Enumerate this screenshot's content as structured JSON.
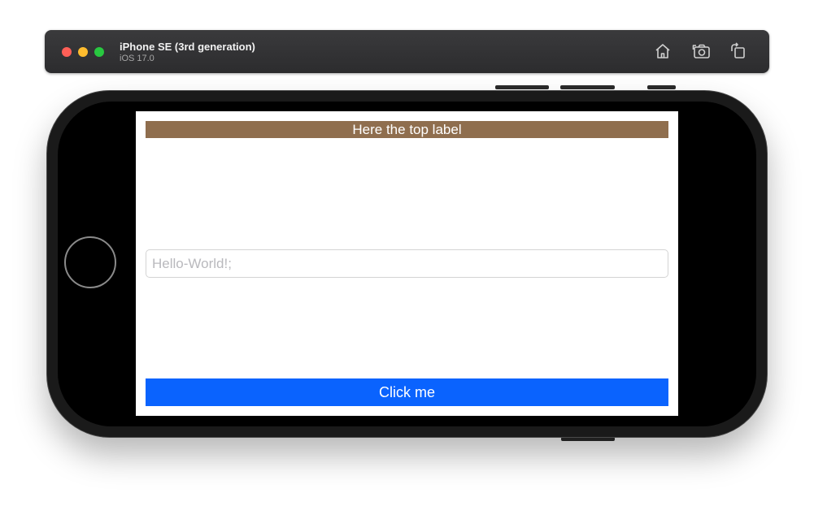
{
  "simulator": {
    "device_name": "iPhone SE (3rd generation)",
    "os_version": "iOS 17.0",
    "toolbar_icons": [
      "home-icon",
      "screenshot-icon",
      "rotate-icon"
    ]
  },
  "app": {
    "top_label": "Here the top label",
    "text_field": {
      "value": "",
      "placeholder": "Hello-World!;"
    },
    "button_label": "Click me"
  },
  "colors": {
    "top_label_bg": "#8f6e4e",
    "button_bg": "#0a63fe",
    "titlebar_bg": "#2c2c2e"
  }
}
